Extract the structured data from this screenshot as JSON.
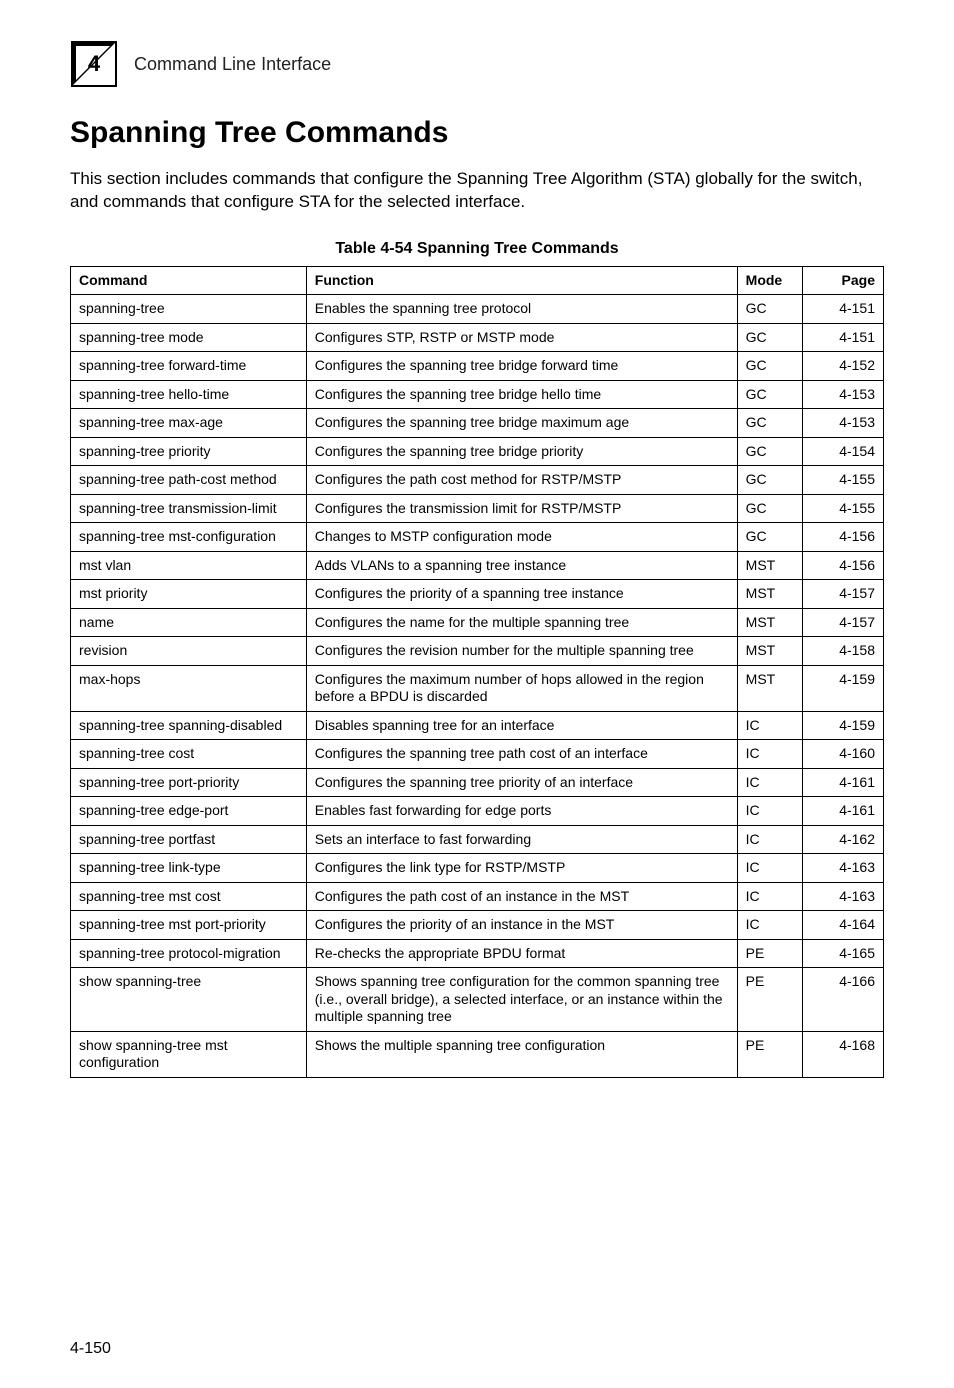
{
  "chapter_badge": "4",
  "running_head": "Command Line Interface",
  "section_title": "Spanning Tree Commands",
  "intro": "This section includes commands that configure the Spanning Tree Algorithm (STA) globally for the switch, and commands that configure STA for the selected interface.",
  "table_caption": "Table 4-54   Spanning Tree Commands",
  "columns": {
    "cmd": "Command",
    "func": "Function",
    "mode": "Mode",
    "page": "Page"
  },
  "rows": [
    {
      "cmd": "spanning-tree",
      "func": "Enables the spanning tree protocol",
      "mode": "GC",
      "page": "4-151"
    },
    {
      "cmd": "spanning-tree mode",
      "func": "Configures STP, RSTP or MSTP mode",
      "mode": "GC",
      "page": "4-151"
    },
    {
      "cmd": "spanning-tree forward-time",
      "func": "Configures the spanning tree bridge forward time",
      "mode": "GC",
      "page": "4-152"
    },
    {
      "cmd": "spanning-tree hello-time",
      "func": "Configures the spanning tree bridge hello time",
      "mode": "GC",
      "page": "4-153"
    },
    {
      "cmd": "spanning-tree max-age",
      "func": "Configures the spanning tree bridge maximum age",
      "mode": "GC",
      "page": "4-153"
    },
    {
      "cmd": "spanning-tree priority",
      "func": "Configures the spanning tree bridge priority",
      "mode": "GC",
      "page": "4-154"
    },
    {
      "cmd": "spanning-tree path-cost method",
      "func": "Configures the path cost method for RSTP/MSTP",
      "mode": "GC",
      "page": "4-155"
    },
    {
      "cmd": "spanning-tree transmission-limit",
      "func": "Configures the transmission limit for RSTP/MSTP",
      "mode": "GC",
      "page": "4-155"
    },
    {
      "cmd": "spanning-tree mst-configuration",
      "func": "Changes to MSTP configuration mode",
      "mode": "GC",
      "page": "4-156"
    },
    {
      "cmd": "mst vlan",
      "func": "Adds VLANs to a spanning tree instance",
      "mode": "MST",
      "page": "4-156"
    },
    {
      "cmd": "mst priority",
      "func": "Configures the priority of a spanning tree instance",
      "mode": "MST",
      "page": "4-157"
    },
    {
      "cmd": "name",
      "func": "Configures the name for the multiple spanning tree",
      "mode": "MST",
      "page": "4-157"
    },
    {
      "cmd": "revision",
      "func": "Configures the revision number for the multiple spanning tree",
      "mode": "MST",
      "page": "4-158"
    },
    {
      "cmd": "max-hops",
      "func": "Configures the maximum number of hops allowed in the region before a BPDU is discarded",
      "mode": "MST",
      "page": "4-159"
    },
    {
      "cmd": "spanning-tree spanning-disabled",
      "func": "Disables spanning tree for an interface",
      "mode": "IC",
      "page": "4-159"
    },
    {
      "cmd": "spanning-tree cost",
      "func": "Configures the spanning tree path cost of an interface",
      "mode": "IC",
      "page": "4-160"
    },
    {
      "cmd": "spanning-tree port-priority",
      "func": "Configures the spanning tree priority of an interface",
      "mode": "IC",
      "page": "4-161"
    },
    {
      "cmd": "spanning-tree edge-port",
      "func": "Enables fast forwarding for edge ports",
      "mode": "IC",
      "page": "4-161"
    },
    {
      "cmd": "spanning-tree portfast",
      "func": "Sets an interface to fast forwarding",
      "mode": "IC",
      "page": "4-162"
    },
    {
      "cmd": "spanning-tree link-type",
      "func": "Configures the link type for RSTP/MSTP",
      "mode": "IC",
      "page": "4-163"
    },
    {
      "cmd": "spanning-tree mst cost",
      "func": "Configures the path cost of an instance in the MST",
      "mode": "IC",
      "page": "4-163"
    },
    {
      "cmd": "spanning-tree mst port-priority",
      "func": "Configures the priority of an instance in the MST",
      "mode": "IC",
      "page": "4-164"
    },
    {
      "cmd": "spanning-tree protocol-migration",
      "func": "Re-checks the appropriate BPDU format",
      "mode": "PE",
      "page": "4-165"
    },
    {
      "cmd": "show spanning-tree",
      "func": "Shows spanning tree configuration for the common spanning tree (i.e., overall bridge), a selected interface, or an instance within the multiple spanning tree",
      "mode": "PE",
      "page": "4-166"
    },
    {
      "cmd": "show spanning-tree mst configuration",
      "func": "Shows the multiple spanning tree configuration",
      "mode": "PE",
      "page": "4-168"
    }
  ],
  "page_number": "4-150"
}
